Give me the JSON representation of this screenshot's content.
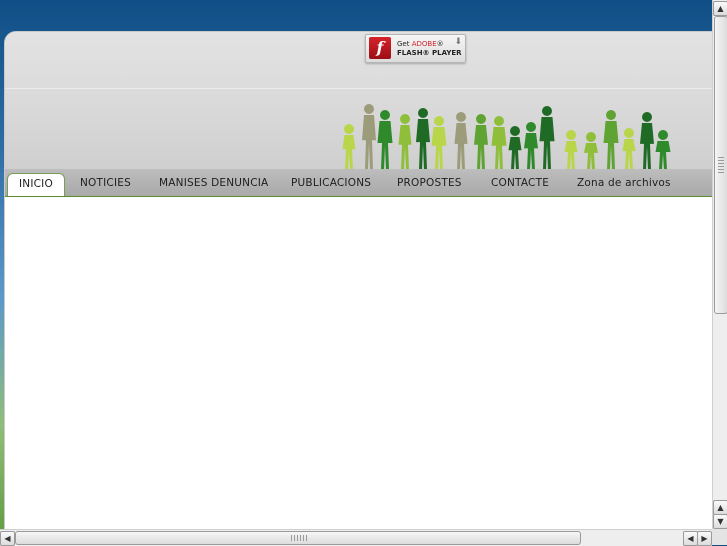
{
  "flash_badge": {
    "line1_prefix": "Get ",
    "line1_brand": "ADOBE",
    "line1_suffix": "®",
    "line2": "FLASH® PLAYER",
    "logo_glyph": "f",
    "arrow_glyph": "⬇"
  },
  "nav": {
    "tabs": [
      {
        "label": "INICIO",
        "active": true
      },
      {
        "label": "NOTICIES",
        "active": false
      },
      {
        "label": "MANISES DENUNCIA",
        "active": false
      },
      {
        "label": "PUBLICACIONS",
        "active": false
      },
      {
        "label": "PROPOSTES",
        "active": false
      },
      {
        "label": "CONTACTE",
        "active": false
      },
      {
        "label": "Zona de archivos",
        "active": false
      }
    ]
  },
  "scrollbars": {
    "up_glyph": "▲",
    "down_glyph": "▼",
    "left_glyph": "◀",
    "right_glyph": "▶"
  },
  "colors": {
    "nav_accent": "#5d8a2e",
    "people_palette": [
      "#b9d64a",
      "#8fbf3a",
      "#5fa332",
      "#2f8a2c",
      "#1f6a24",
      "#9c9c7a"
    ]
  },
  "icons": {
    "flash": "flash-player-icon",
    "people": "people-silhouettes-banner"
  }
}
